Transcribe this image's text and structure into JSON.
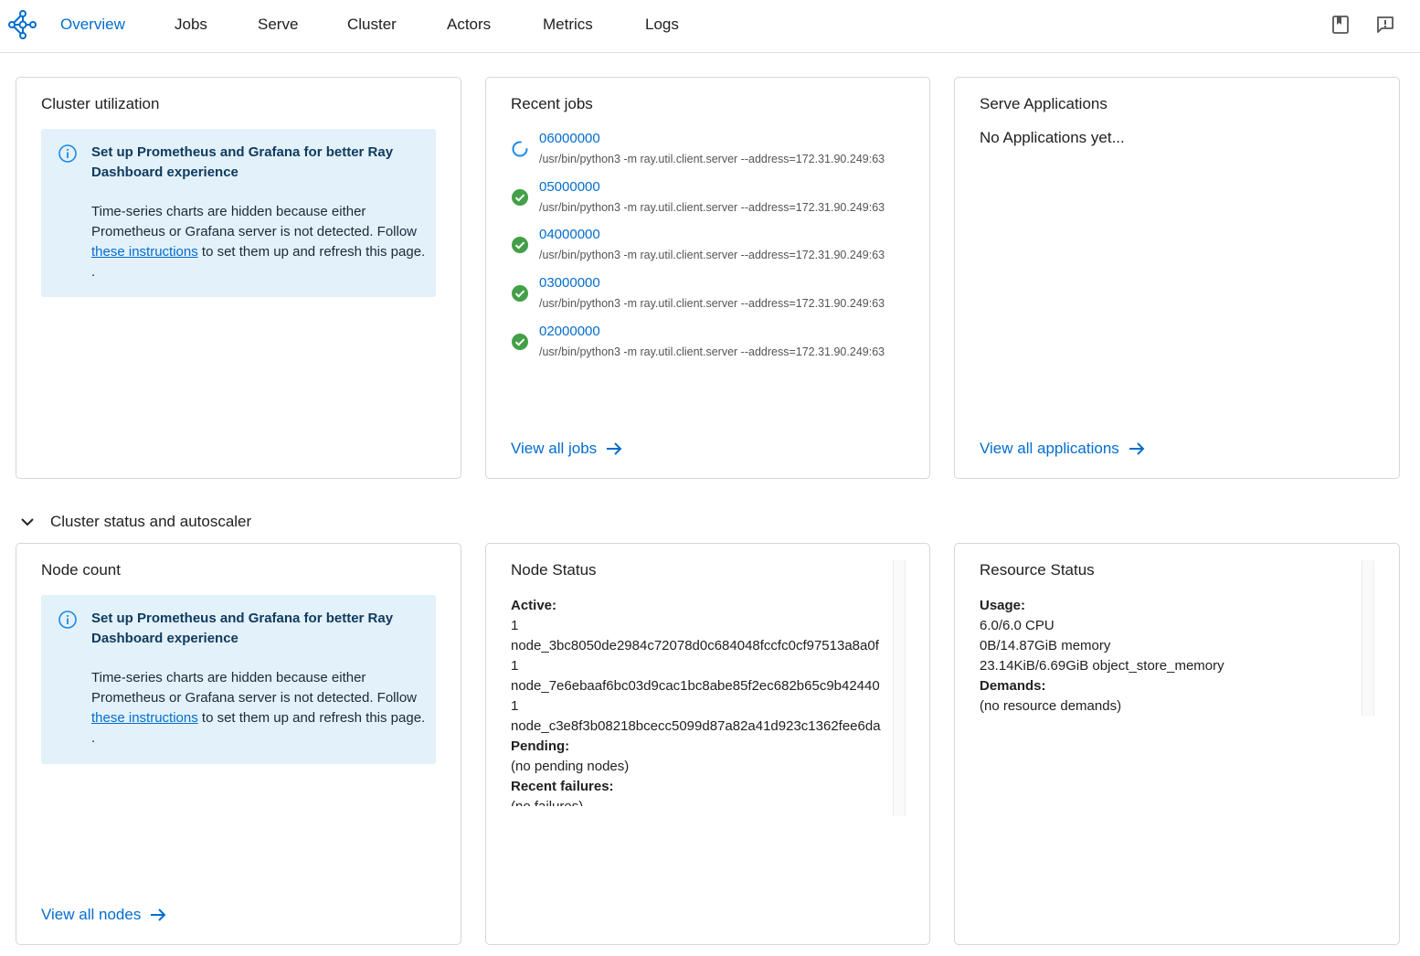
{
  "nav": {
    "items": [
      "Overview",
      "Jobs",
      "Serve",
      "Cluster",
      "Actors",
      "Metrics",
      "Logs"
    ],
    "active": "Overview",
    "icons": [
      "ray-logo-icon",
      "docs-book-icon",
      "feedback-icon"
    ]
  },
  "cluster_utilization": {
    "title": "Cluster utilization",
    "info_title": "Set up Prometheus and Grafana for better Ray Dashboard experience",
    "info_body_1": "Time-series charts are hidden because either Prometheus or Grafana server is not detected. Follow ",
    "info_link": "these instructions",
    "info_body_2": " to set them up and refresh this page. ."
  },
  "recent_jobs": {
    "title": "Recent jobs",
    "jobs": [
      {
        "id": "06000000",
        "status": "running",
        "cmd": "/usr/bin/python3 -m ray.util.client.server --address=172.31.90.249:63"
      },
      {
        "id": "05000000",
        "status": "succeeded",
        "cmd": "/usr/bin/python3 -m ray.util.client.server --address=172.31.90.249:63"
      },
      {
        "id": "04000000",
        "status": "succeeded",
        "cmd": "/usr/bin/python3 -m ray.util.client.server --address=172.31.90.249:63"
      },
      {
        "id": "03000000",
        "status": "succeeded",
        "cmd": "/usr/bin/python3 -m ray.util.client.server --address=172.31.90.249:63"
      },
      {
        "id": "02000000",
        "status": "succeeded",
        "cmd": "/usr/bin/python3 -m ray.util.client.server --address=172.31.90.249:63"
      }
    ],
    "view_all": "View all jobs"
  },
  "serve_apps": {
    "title": "Serve Applications",
    "empty": "No Applications yet...",
    "view_all": "View all applications"
  },
  "section": {
    "title": "Cluster status and autoscaler"
  },
  "node_count": {
    "title": "Node count",
    "info_title": "Set up Prometheus and Grafana for better Ray Dashboard experience",
    "info_body_1": "Time-series charts are hidden because either Prometheus or Grafana server is not detected. Follow ",
    "info_link": "these instructions",
    "info_body_2": " to set them up and refresh this page. .",
    "view_all": "View all nodes"
  },
  "node_status": {
    "title": "Node Status",
    "active_label": "Active:",
    "active_nodes": [
      {
        "count": "1",
        "name": "node_3bc8050de2984c72078d0c684048fccfc0cf97513a8a0f"
      },
      {
        "count": "1",
        "name": "node_7e6ebaaf6bc03d9cac1bc8abe85f2ec682b65c9b42440"
      },
      {
        "count": "1",
        "name": "node_c3e8f3b08218bcecc5099d87a82a41d923c1362fee6da"
      }
    ],
    "pending_label": "Pending:",
    "pending_value": "(no pending nodes)",
    "failures_label": "Recent failures:",
    "failures_value": "(no failures)"
  },
  "resource_status": {
    "title": "Resource Status",
    "usage_label": "Usage:",
    "usage_lines": [
      "6.0/6.0 CPU",
      "0B/14.87GiB memory",
      "23.14KiB/6.69GiB object_store_memory"
    ],
    "demands_label": "Demands:",
    "demands_value": "(no resource demands)"
  },
  "colors": {
    "accent": "#036dcf",
    "success": "#43a047",
    "info_bg": "#e3f1fb"
  }
}
